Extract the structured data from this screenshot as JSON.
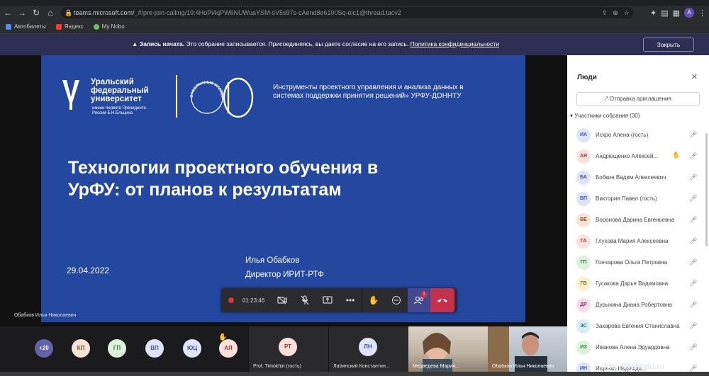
{
  "browser": {
    "url_host": "teams.microsoft.com/",
    "url_path": "_#/pre-join-calling/19:4HoPl4qPW6NUWuaYSM-sV5s97s-cAend8e6100Sq-elc1@thread.tacv2",
    "bookmarks": [
      {
        "label": "Автобилеты",
        "color": "#4f8cf0"
      },
      {
        "label": "Яндекс",
        "color": "#ff3b2f"
      },
      {
        "label": "My Nobo",
        "color": "#66c25a"
      }
    ],
    "profile_initial": "A"
  },
  "banner": {
    "lead": "Запись начата.",
    "text": " Это собрание записывается. Присоединяясь, вы даете согласие на его запись.",
    "link": "Политика конфиденциальности",
    "close_label": "Закрыть"
  },
  "slide": {
    "university_name": [
      "Уральский",
      "федеральный",
      "университет"
    ],
    "university_sub": [
      "имени первого Президента",
      "России Б.Н.Ельцина"
    ],
    "seal_text": "ОТОБРАННЫЕ УНИВЕРСИТЕТА",
    "description": [
      "Инструменты проектного управления и анализа данных в",
      "системах поддержки принятия решений» УРФУ-ДОННТУ"
    ],
    "title_line1": "Технологии проектного обучения в",
    "title_line2": "УрФУ: от планов к результатам",
    "date": "29.04.2022",
    "author_name": "Илья Обабков",
    "author_role": "Директор ИРИТ-РТФ"
  },
  "presenter_label": "Обабков Илья Николаевич",
  "controls": {
    "timer": "01:23:46",
    "people_badge": "1"
  },
  "people_panel": {
    "title": "Люди",
    "share_label": "Отправка приглашения",
    "section_label": "Участники собрания (30)",
    "participants": [
      {
        "initials": "ИА",
        "name": "Искро Алена (гость)",
        "bg": "#dfe4fa",
        "fg": "#4150a8",
        "hand": false
      },
      {
        "initials": "АЯ",
        "name": "Андрющенко Алексей...",
        "bg": "#fbe0dc",
        "fg": "#a33a28",
        "hand": true
      },
      {
        "initials": "БА",
        "name": "Бобкин Вадим Алексеевич",
        "bg": "#dfe4fa",
        "fg": "#4150a8",
        "hand": false
      },
      {
        "initials": "ВП",
        "name": "Виктория Павел (гость)",
        "bg": "#dfe4fa",
        "fg": "#4150a8",
        "hand": false
      },
      {
        "initials": "ВЕ",
        "name": "Воронова Дарина Евгеньевна",
        "bg": "#f6e3d4",
        "fg": "#8a4a1e",
        "hand": false
      },
      {
        "initials": "ГА",
        "name": "Глухова Мария Алексеевна",
        "bg": "#fbe0dc",
        "fg": "#a33a28",
        "hand": false
      },
      {
        "initials": "ГП",
        "name": "Гончарова Ольга Петровна",
        "bg": "#dcf2dc",
        "fg": "#2f7a2f",
        "hand": false
      },
      {
        "initials": "ГВ",
        "name": "Гусакова Дарья Вадимовна",
        "bg": "#fbf0cf",
        "fg": "#8a6a00",
        "hand": false
      },
      {
        "initials": "ДР",
        "name": "Дурыкина Диана Робертовна",
        "bg": "#f7dcea",
        "fg": "#9a2e64",
        "hand": false
      },
      {
        "initials": "ЗС",
        "name": "Захарова Евгения Станиславна",
        "bg": "#d8eef0",
        "fg": "#1f6d75",
        "hand": false
      },
      {
        "initials": "ИЗ",
        "name": "Иванова Алена Эдуардовна",
        "bg": "#dcf2dc",
        "fg": "#2f7a2f",
        "hand": false
      },
      {
        "initials": "ИН",
        "name": "Ищенко Надежда...",
        "bg": "#dfe4fa",
        "fg": "#4150a8",
        "hand": false
      }
    ]
  },
  "gallery": {
    "overflow_count": "+20",
    "avatars": [
      {
        "initials": "КП",
        "bg": "#f6e3d4",
        "fg": "#8a4a1e"
      },
      {
        "initials": "ГП",
        "bg": "#dcf2dc",
        "fg": "#2f7a2f"
      },
      {
        "initials": "ВП",
        "bg": "#dfe4fa",
        "fg": "#4150a8"
      },
      {
        "initials": "ЮЦ",
        "bg": "#dfe4fa",
        "fg": "#4150a8"
      },
      {
        "initials": "АЯ",
        "bg": "#fbe0dc",
        "fg": "#a33a28"
      }
    ],
    "tile1": {
      "initials": "РТ",
      "name": "Prof. Timokhin (гость)",
      "bg": "#fbe0dc",
      "fg": "#a33a28"
    },
    "tile2": {
      "initials": "ЛН",
      "name": "Лабинский Константин...",
      "bg": "#dfe4fa",
      "fg": "#4150a8"
    },
    "tile3": {
      "name": "Медведева Мария..."
    },
    "tile4": {
      "name": "Обабков Илья Николаевич"
    }
  },
  "watermark": "http://dohhdu.ru"
}
